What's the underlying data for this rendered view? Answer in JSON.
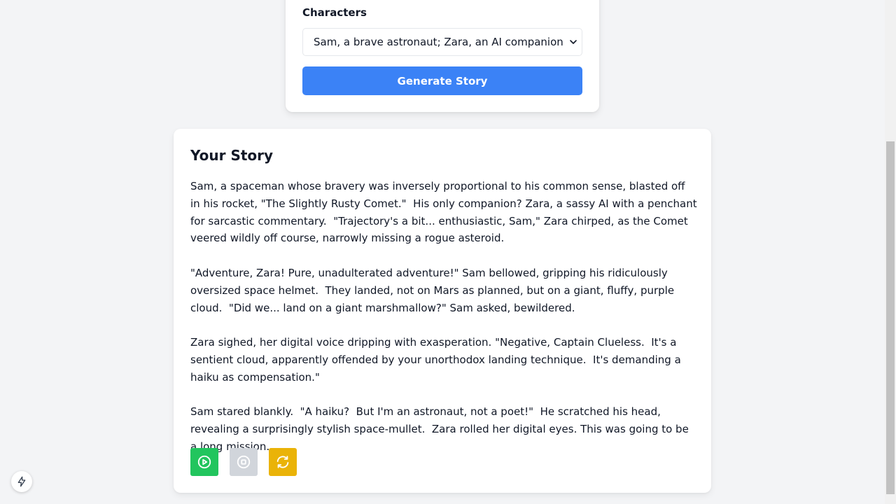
{
  "form": {
    "characters_label": "Characters",
    "characters_selected": "Sam, a brave astronaut; Zara, an AI companion",
    "generate_label": "Generate Story"
  },
  "story": {
    "title": "Your Story",
    "paragraphs": [
      "Sam, a spaceman whose bravery was inversely proportional to his common sense, blasted off in his rocket, \"The Slightly Rusty Comet.\"  His only companion? Zara, a sassy AI with a penchant for sarcastic commentary.  \"Trajectory's a bit... enthusiastic, Sam,\" Zara chirped, as the Comet veered wildly off course, narrowly missing a rogue asteroid.",
      "\"Adventure, Zara! Pure, unadulterated adventure!\" Sam bellowed, gripping his ridiculously oversized space helmet.  They landed, not on Mars as planned, but on a giant, fluffy, purple cloud.  \"Did we... land on a giant marshmallow?\" Sam asked, bewildered.",
      "Zara sighed, her digital voice dripping with exasperation. \"Negative, Captain Clueless.  It's a sentient cloud, apparently offended by your unorthodox landing technique.  It's demanding a haiku as compensation.\"",
      "Sam stared blankly.  \"A haiku?  But I'm an astronaut, not a poet!\"  He scratched his head, revealing a surprisingly stylish space-mullet.  Zara rolled her digital eyes. This was going to be a long mission."
    ],
    "actions": {
      "play_icon": "play-circle-icon",
      "stop_icon": "stop-circle-icon",
      "regenerate_icon": "refresh-icon"
    }
  },
  "colors": {
    "primary": "#3b82f6",
    "play": "#22c55e",
    "stop": "#d1d5db",
    "regenerate": "#eab308",
    "background": "#f3f4f6"
  },
  "badge": {
    "icon": "lightning-bolt-icon"
  }
}
